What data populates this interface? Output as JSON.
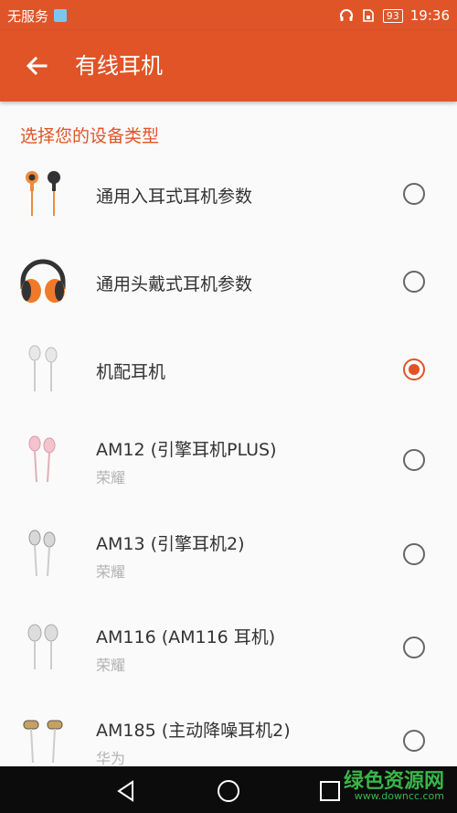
{
  "status": {
    "carrier": "无服务",
    "battery": "93",
    "time": "19:36"
  },
  "appbar": {
    "title": "有线耳机"
  },
  "section_title": "选择您的设备类型",
  "items": [
    {
      "label": "通用入耳式耳机参数",
      "brand": "",
      "selected": false
    },
    {
      "label": "通用头戴式耳机参数",
      "brand": "",
      "selected": false
    },
    {
      "label": "机配耳机",
      "brand": "",
      "selected": true
    },
    {
      "label": "AM12 (引擎耳机PLUS)",
      "brand": "荣耀",
      "selected": false
    },
    {
      "label": "AM13 (引擎耳机2)",
      "brand": "荣耀",
      "selected": false
    },
    {
      "label": "AM116 (AM116 耳机)",
      "brand": "荣耀",
      "selected": false
    },
    {
      "label": "AM185 (主动降噪耳机2)",
      "brand": "华为",
      "selected": false
    }
  ],
  "watermark": {
    "text": "绿色资源网",
    "url": "www.downcc.com"
  },
  "colors": {
    "accent": "#e05428"
  }
}
